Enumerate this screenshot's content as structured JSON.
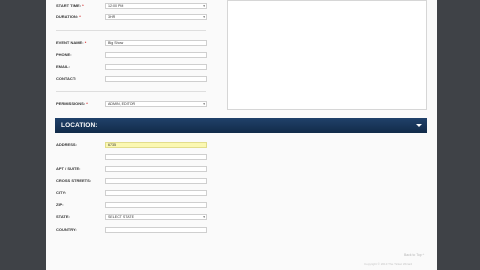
{
  "event": {
    "start_time": {
      "label": "START TIME:",
      "required": "*",
      "value": "12:00 PM"
    },
    "duration": {
      "label": "DURATION:",
      "required": "*",
      "value": "3HR"
    },
    "event_name": {
      "label": "EVENT NAME:",
      "required": "*",
      "value": "Big Show"
    },
    "phone": {
      "label": "PHONE:",
      "value": ""
    },
    "email": {
      "label": "EMAIL:",
      "value": ""
    },
    "contact": {
      "label": "CONTACT:",
      "value": ""
    },
    "permissions": {
      "label": "PERMISSIONS:",
      "required": "*",
      "value": "ADMIN, EDITOR"
    }
  },
  "location": {
    "section_title": "LOCATION:",
    "address": {
      "label": "ADDRESS:",
      "value": "6735"
    },
    "apt_suite": {
      "label": "APT / SUITE:",
      "value": ""
    },
    "cross_streets": {
      "label": "CROSS STREETS:",
      "value": ""
    },
    "city": {
      "label": "CITY:",
      "value": ""
    },
    "zip": {
      "label": "ZIP:",
      "value": ""
    },
    "state": {
      "label": "STATE:",
      "value": "SELECT STATE"
    },
    "country": {
      "label": "COUNTRY:",
      "value": ""
    }
  },
  "footer": {
    "back_to_top": "Back to Top ^",
    "copyright": "Copyright © 2013 The Ticket Wizard"
  },
  "colors": {
    "section_bar": "#1b3657",
    "highlight": "#fbf8b2",
    "background": "#3f4247"
  },
  "icons": {
    "dropdown": "triangle-down",
    "collapse": "caret-down"
  }
}
